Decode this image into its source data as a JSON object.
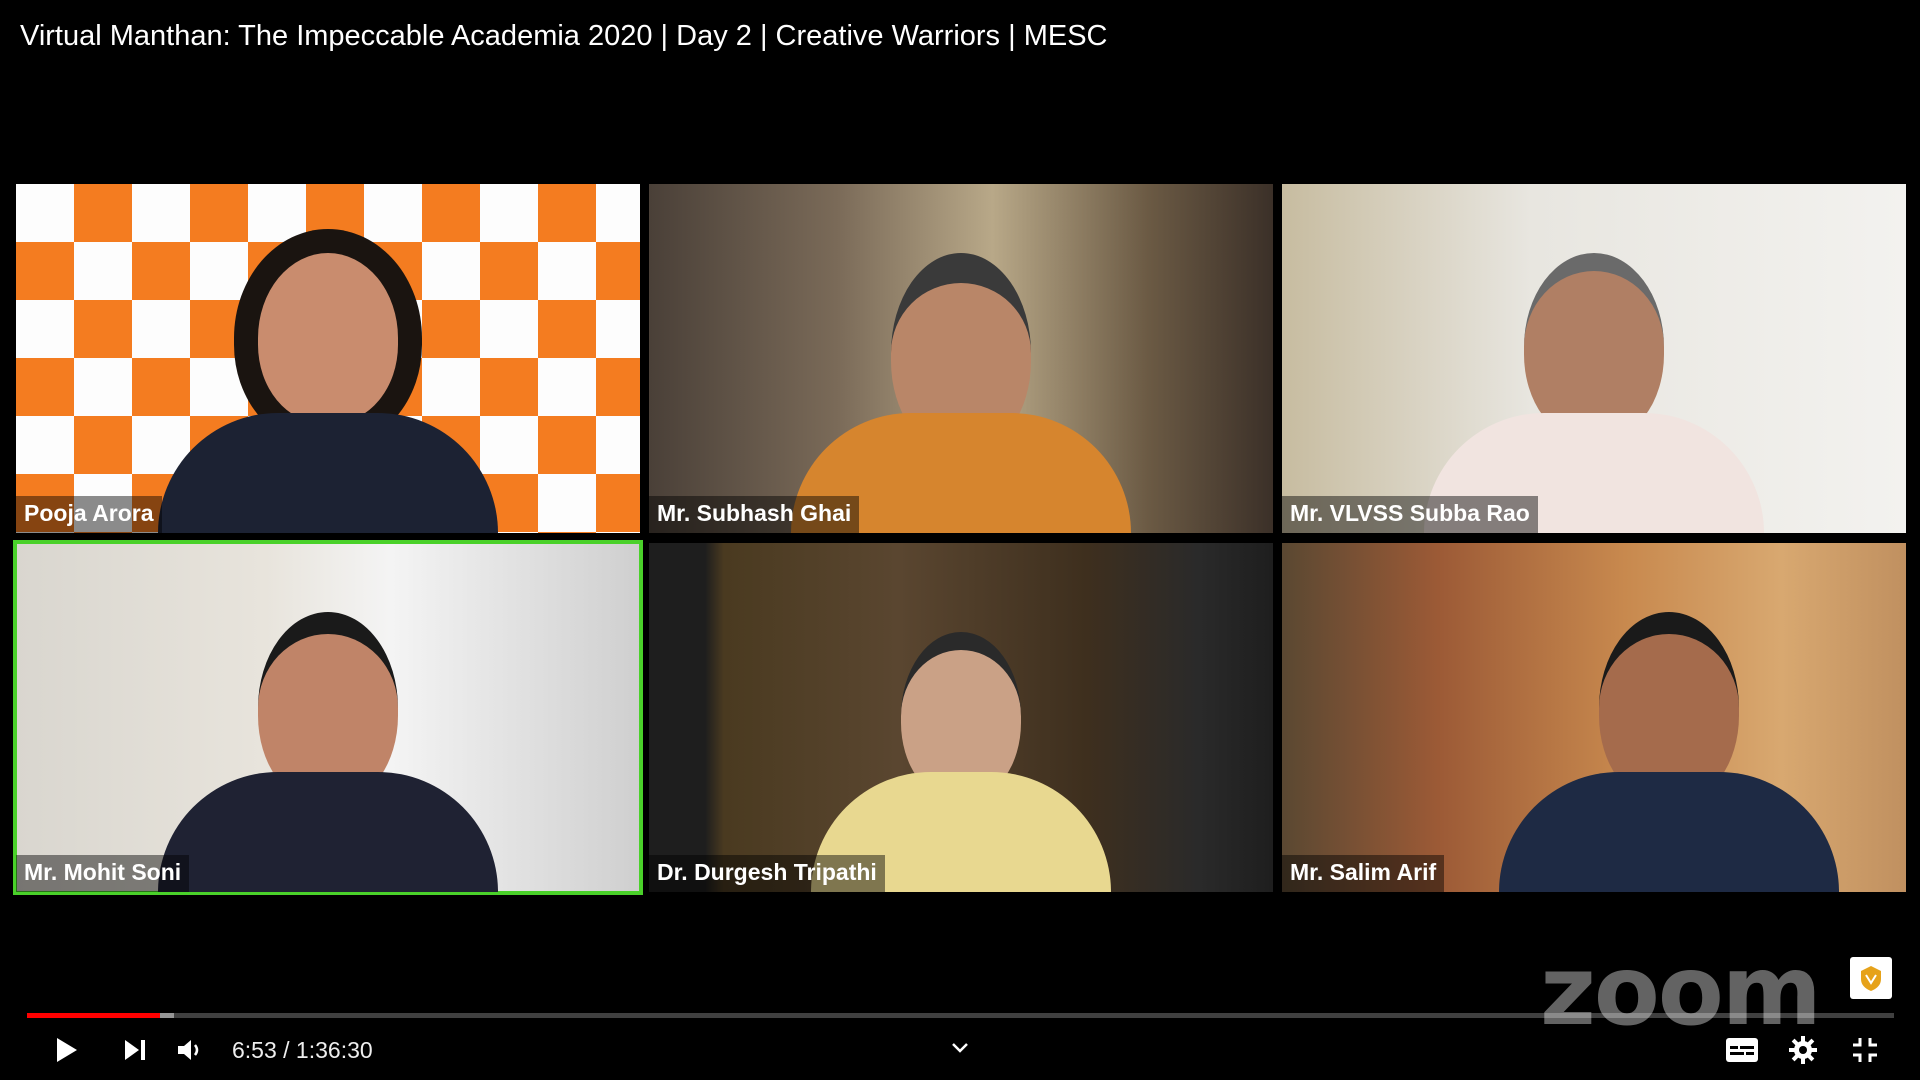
{
  "video": {
    "title": "Virtual Manthan: The Impeccable Academia 2020 | Day 2 | Creative Warriors | MESC"
  },
  "participants": [
    {
      "name": "Pooja Arora",
      "active": false
    },
    {
      "name": "Mr. Subhash Ghai",
      "active": false
    },
    {
      "name": "Mr. VLVSS Subba Rao",
      "active": false
    },
    {
      "name": "Mr. Mohit Soni",
      "active": true
    },
    {
      "name": "Dr. Durgesh Tripathi",
      "active": false
    },
    {
      "name": "Mr. Salim Arif",
      "active": false
    }
  ],
  "player": {
    "current_time": "6:53",
    "duration": "1:36:30",
    "time_display": "6:53 / 1:36:30",
    "played_fraction": 0.071,
    "buffered_fraction": 0.065,
    "watermark": "zoom",
    "controls": [
      "play-icon",
      "next-icon",
      "volume-icon",
      "chevron-down-icon",
      "subtitles-icon",
      "settings-icon",
      "exit-fullscreen-icon"
    ]
  },
  "colors": {
    "active_speaker_border": "#4ad12a",
    "progress_played": "#ff0000",
    "checker_orange": "#f47c20"
  }
}
